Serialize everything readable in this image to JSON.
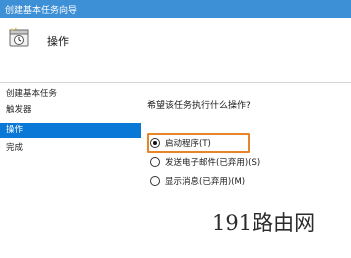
{
  "window": {
    "title": "创建基本任务向导"
  },
  "header": {
    "icon": "task-clock-icon",
    "title": "操作"
  },
  "sidebar": {
    "items": [
      {
        "label": "创建基本任务",
        "selected": false
      },
      {
        "label": "触发器",
        "selected": false
      },
      {
        "label": "操作",
        "selected": true
      },
      {
        "label": "完成",
        "selected": false
      }
    ]
  },
  "main": {
    "question": "希望该任务执行什么操作?",
    "options": [
      {
        "label": "启动程序(T)",
        "checked": true
      },
      {
        "label": "发送电子邮件(已弃用)(S)",
        "checked": false
      },
      {
        "label": "显示消息(已弃用)(M)",
        "checked": false
      }
    ]
  },
  "colors": {
    "titlebar": "#3d8fd6",
    "selection": "#0a78d7",
    "highlight": "#e8852b"
  },
  "watermark": "191路由网"
}
